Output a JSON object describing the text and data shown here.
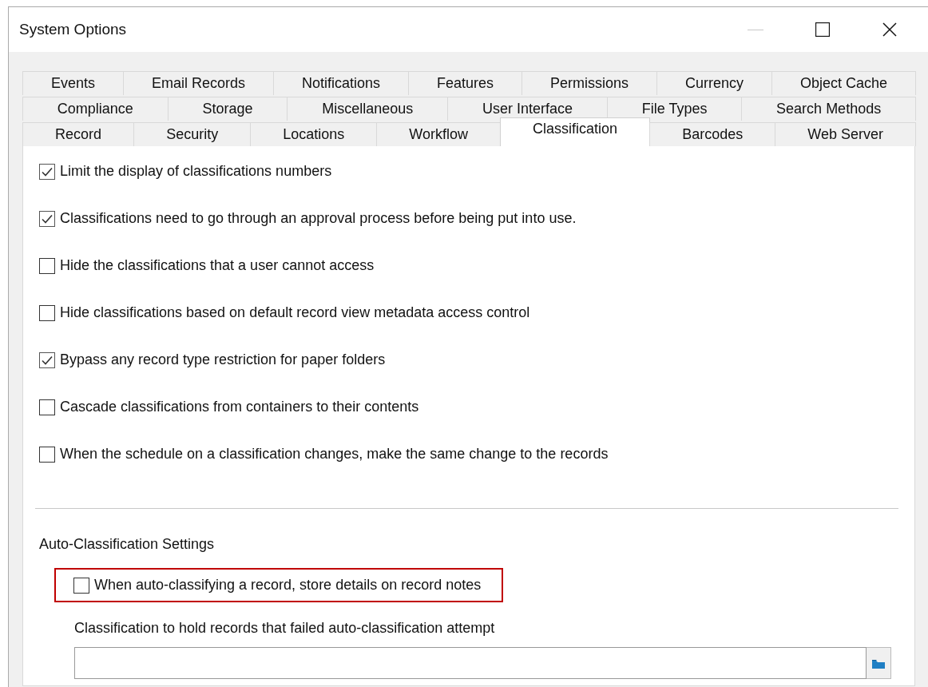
{
  "window": {
    "title": "System Options"
  },
  "tab_rows": [
    {
      "tabs": [
        {
          "label": "Events",
          "selected": false
        },
        {
          "label": "Email Records",
          "selected": false
        },
        {
          "label": "Notifications",
          "selected": false
        },
        {
          "label": "Features",
          "selected": false
        },
        {
          "label": "Permissions",
          "selected": false
        },
        {
          "label": "Currency",
          "selected": false
        },
        {
          "label": "Object Cache",
          "selected": false
        }
      ]
    },
    {
      "tabs": [
        {
          "label": "Compliance",
          "selected": false
        },
        {
          "label": "Storage",
          "selected": false
        },
        {
          "label": "Miscellaneous",
          "selected": false
        },
        {
          "label": "User Interface",
          "selected": false
        },
        {
          "label": "File Types",
          "selected": false
        },
        {
          "label": "Search Methods",
          "selected": false
        }
      ]
    },
    {
      "tabs": [
        {
          "label": "Record",
          "selected": false
        },
        {
          "label": "Security",
          "selected": false
        },
        {
          "label": "Locations",
          "selected": false
        },
        {
          "label": "Workflow",
          "selected": false
        },
        {
          "label": "Classification",
          "selected": true
        },
        {
          "label": "Barcodes",
          "selected": false
        },
        {
          "label": "Web Server",
          "selected": false
        }
      ]
    }
  ],
  "options": [
    {
      "label": "Limit the display of classifications numbers",
      "checked": true
    },
    {
      "label": "Classifications need to go through an approval process before being put into use.",
      "checked": true
    },
    {
      "label": "Hide the classifications that a user cannot access",
      "checked": false
    },
    {
      "label": "Hide classifications based on default record view metadata access control",
      "checked": false
    },
    {
      "label": "Bypass any record type restriction for paper folders",
      "checked": true
    },
    {
      "label": "Cascade classifications from containers to their contents",
      "checked": false
    },
    {
      "label": "When the schedule on a classification changes, make the same change to the records",
      "checked": false
    }
  ],
  "auto_classification": {
    "heading": "Auto-Classification Settings",
    "options": [
      {
        "label": "When auto-classifying a record, store details on record notes",
        "checked": false,
        "highlighted": true
      }
    ],
    "field": {
      "label": "Classification to hold records that failed auto-classification attempt"
    }
  }
}
